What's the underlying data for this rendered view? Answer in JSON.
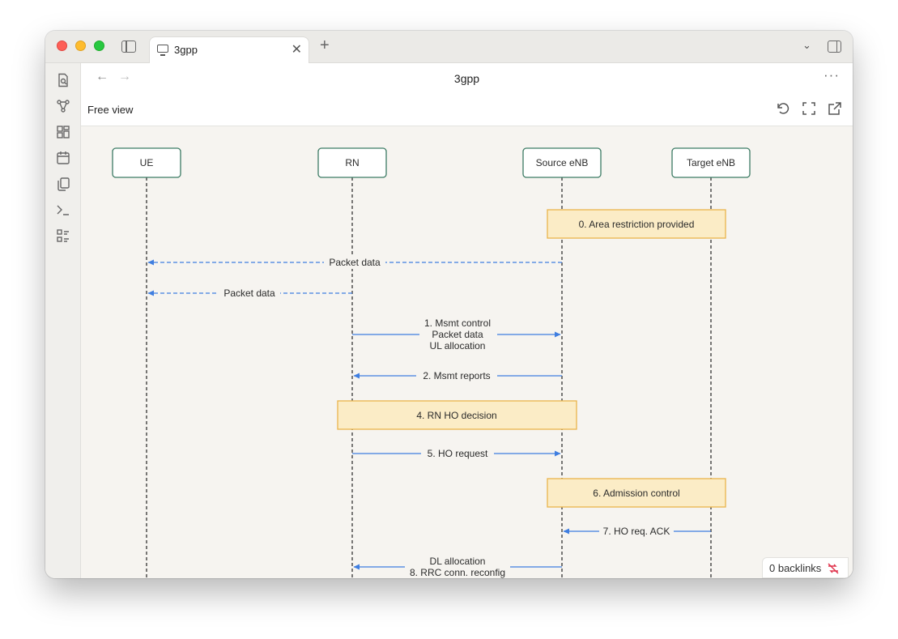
{
  "tab": {
    "title": "3gpp"
  },
  "header": {
    "title": "3gpp",
    "subtitle": "Free view"
  },
  "footer": {
    "backlinks": "0 backlinks"
  },
  "diagram": {
    "participants": [
      "UE",
      "RN",
      "Source eNB",
      "Target eNB"
    ],
    "notes": [
      "0. Area restriction provided",
      "4. RN HO decision",
      "6. Admission control"
    ],
    "messages": [
      {
        "lines": [
          "Packet data"
        ],
        "style": "dashed"
      },
      {
        "lines": [
          "Packet data"
        ],
        "style": "dashed"
      },
      {
        "lines": [
          "1. Msmt control",
          "Packet data",
          "UL allocation"
        ],
        "style": "solid"
      },
      {
        "lines": [
          "2. Msmt reports"
        ],
        "style": "solid"
      },
      {
        "lines": [
          "5. HO request"
        ],
        "style": "solid"
      },
      {
        "lines": [
          "7. HO req. ACK"
        ],
        "style": "solid"
      },
      {
        "lines": [
          "DL allocation",
          "8. RRC conn. reconfig"
        ],
        "style": "solid"
      }
    ]
  },
  "colors": {
    "participant_border": "#3b7a63",
    "note_fill": "#fbecc6",
    "note_border": "#e9b44c",
    "arrow": "#3f7ee0"
  }
}
